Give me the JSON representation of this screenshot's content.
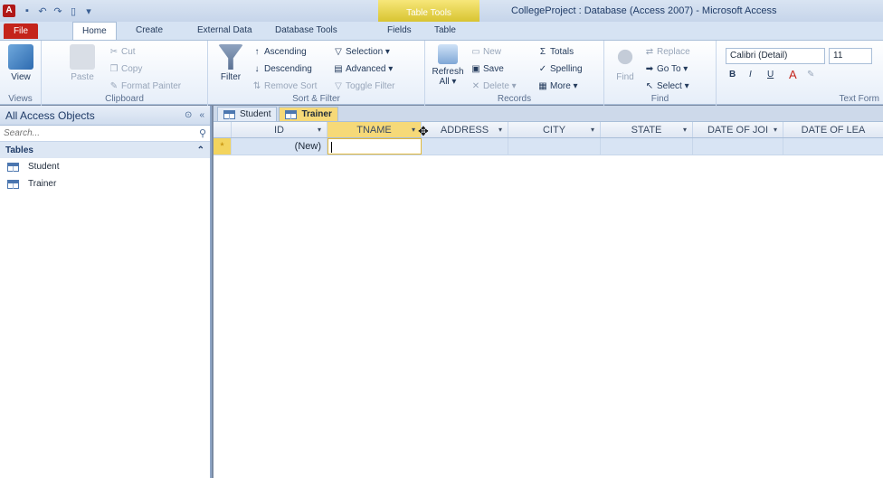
{
  "window": {
    "title": "CollegeProject : Database (Access 2007) - Microsoft Access",
    "contextual_group": "Table Tools",
    "logo": "A"
  },
  "ribbon_tabs": {
    "file": "File",
    "home": "Home",
    "create": "Create",
    "external_data": "External Data",
    "database_tools": "Database Tools",
    "fields": "Fields",
    "table": "Table"
  },
  "ribbon": {
    "views": {
      "view": "View",
      "label": "Views"
    },
    "clipboard": {
      "paste": "Paste",
      "cut": "Cut",
      "copy": "Copy",
      "format_painter": "Format Painter",
      "label": "Clipboard"
    },
    "sort_filter": {
      "filter": "Filter",
      "ascending": "Ascending",
      "descending": "Descending",
      "remove_sort": "Remove Sort",
      "selection": "Selection ▾",
      "advanced": "Advanced ▾",
      "toggle_filter": "Toggle Filter",
      "label": "Sort & Filter"
    },
    "records": {
      "refresh": "Refresh",
      "refresh_sub": "All ▾",
      "new": "New",
      "save": "Save",
      "delete": "Delete ▾",
      "totals": "Totals",
      "spelling": "Spelling",
      "more": "More ▾",
      "label": "Records"
    },
    "find": {
      "find": "Find",
      "replace": "Replace",
      "goto": "Go To ▾",
      "select": "Select ▾",
      "label": "Find"
    },
    "text_formatting": {
      "font": "Calibri (Detail)",
      "size": "11",
      "label": "Text Form"
    }
  },
  "nav_pane": {
    "title": "All Access Objects",
    "search_placeholder": "Search...",
    "group": "Tables",
    "items": [
      "Student",
      "Trainer"
    ]
  },
  "document": {
    "tabs": [
      "Student",
      "Trainer"
    ],
    "active_tab": "Trainer",
    "columns": [
      "ID",
      "TNAME",
      "ADDRESS",
      "CITY",
      "STATE",
      "DATE OF JOI",
      "DATE OF LEA"
    ],
    "new_row": {
      "marker": "*",
      "id": "(New)"
    }
  },
  "colors": {
    "file_tab": "#c4241b",
    "active_column": "#f6d978",
    "new_row": "#d8e4f4"
  }
}
